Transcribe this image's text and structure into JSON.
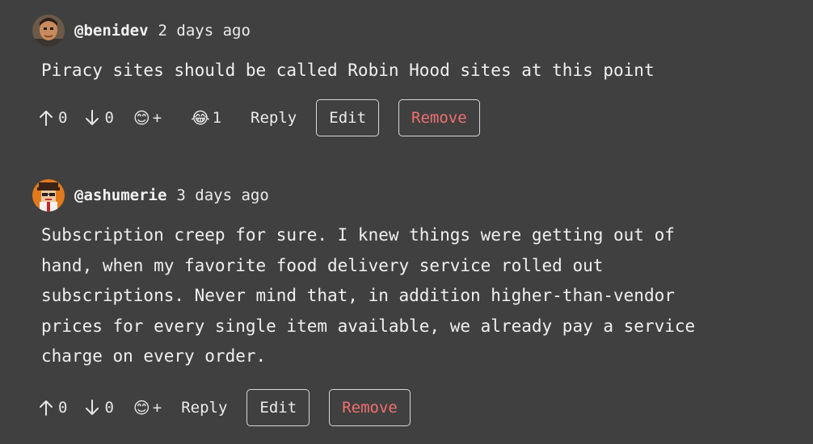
{
  "comments": [
    {
      "username": "@benidev",
      "timestamp": "2 days ago",
      "avatar_icon": "person-avatar-icon",
      "body": "Piracy sites should be called Robin Hood sites at this point",
      "upvotes": "0",
      "downvotes": "0",
      "add_reaction_label": "+",
      "reactions": [
        {
          "emoji": "😂",
          "icon": "laughing-crying-emoji-icon",
          "count": "1"
        }
      ],
      "reply_label": "Reply",
      "edit_label": "Edit",
      "remove_label": "Remove"
    },
    {
      "username": "@ashumerie",
      "timestamp": "3 days ago",
      "avatar_icon": "pixel-avatar-icon",
      "body": "Subscription creep for sure. I knew things were getting out of\nhand, when my favorite food delivery service rolled out\nsubscriptions. Never mind that, in addition higher-than-vendor\nprices for every single item available, we already pay a service\ncharge on every order.",
      "upvotes": "0",
      "downvotes": "0",
      "add_reaction_label": "+",
      "reply_label": "Reply",
      "edit_label": "Edit",
      "remove_label": "Remove"
    }
  ],
  "colors": {
    "background": "#404040",
    "remove_text": "#f07070",
    "button_border": "#d8d8d8"
  }
}
